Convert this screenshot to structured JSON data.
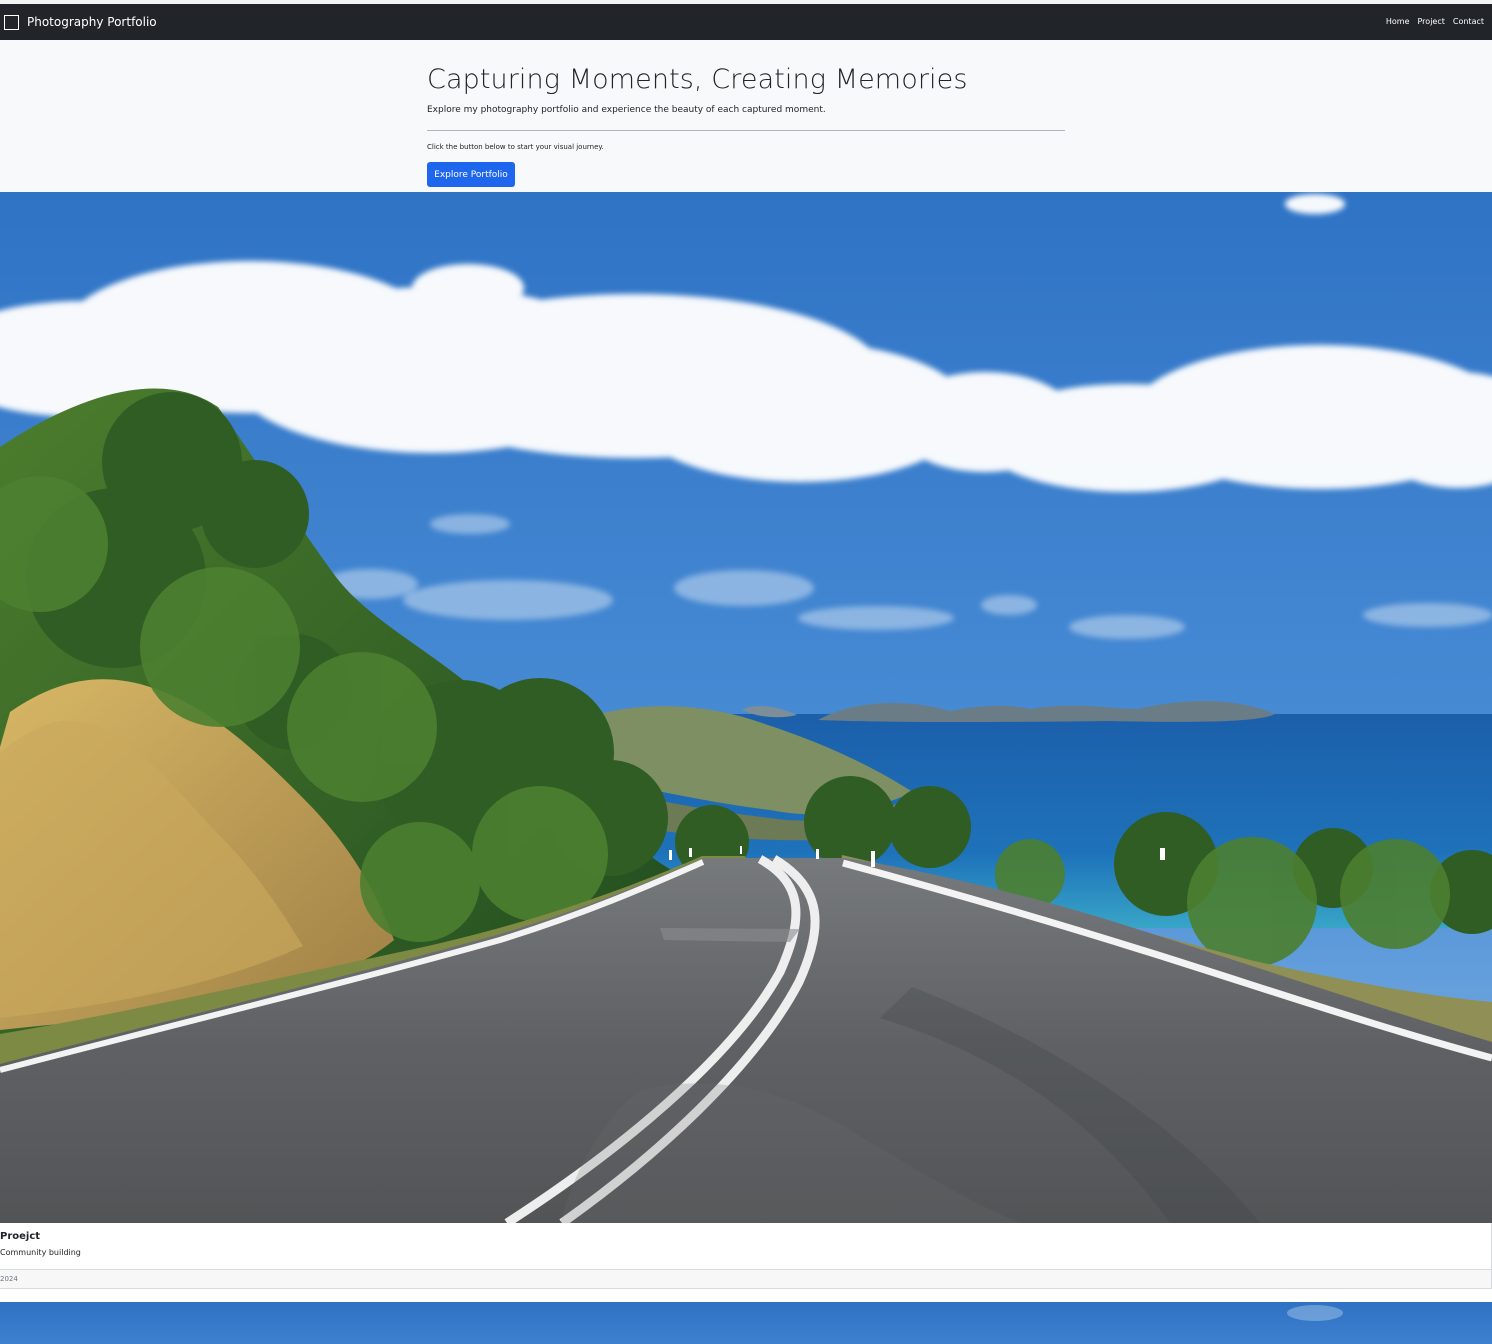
{
  "navbar": {
    "brand_icon": "square-outline-icon",
    "brand": "Photography Portfolio",
    "links": [
      "Home",
      "Project",
      "Contact"
    ]
  },
  "hero": {
    "title": "Capturing Moments, Creating Memories",
    "lead": "Explore my photography portfolio and experience the beauty of each captured moment.",
    "helper": "Click the button below to start your visual journey.",
    "button": "Explore Portfolio"
  },
  "card": {
    "image_alt": "Coastal road winding toward the sea",
    "title": "Proejct",
    "text": "Community building",
    "footer": "2024"
  },
  "colors": {
    "navbar": "#212529",
    "hero_bg": "#f8f9fa",
    "primary_button": "#1f66ee",
    "sky": "#3272c4",
    "sea": "#1f6eb7"
  }
}
